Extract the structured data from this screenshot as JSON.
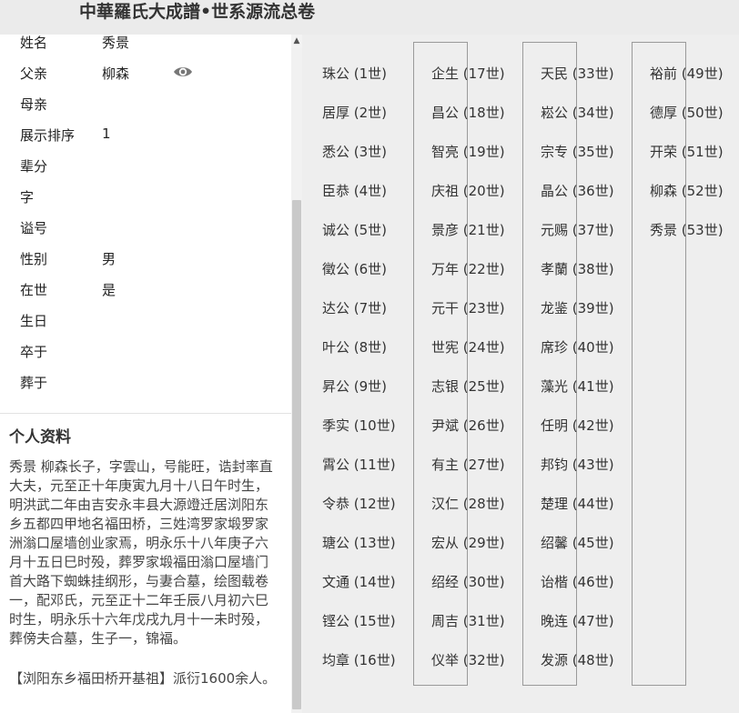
{
  "header": {
    "title": "中華羅氏大成譜•世系源流总卷"
  },
  "profile": {
    "fields": [
      {
        "label": "姓名",
        "value": "秀景"
      },
      {
        "label": "父亲",
        "value": "柳森"
      },
      {
        "label": "母亲",
        "value": ""
      },
      {
        "label": "展示排序",
        "value": "1"
      },
      {
        "label": "辈分",
        "value": ""
      },
      {
        "label": "字",
        "value": ""
      },
      {
        "label": "谥号",
        "value": ""
      },
      {
        "label": "性别",
        "value": "男"
      },
      {
        "label": "在世",
        "value": "是"
      },
      {
        "label": "生日",
        "value": ""
      },
      {
        "label": "卒于",
        "value": ""
      },
      {
        "label": "葬于",
        "value": ""
      }
    ],
    "icons": {
      "view": "eye-icon"
    },
    "section_title": "个人资料",
    "bio": "秀景 柳森长子，字雲山，号能旺，诰封率直大夫，元至正十年庚寅九月十八日午时生，明洪武二年由吉安永丰县大源竳迁居浏阳东乡五都四甲地名福田桥，三姓湾罗家塅罗家洲滃口屋墙创业家焉，明永乐十八年庚子六月十五日巳时殁，葬罗家塅福田滃口屋墙门首大路下蜘蛛挂纲形，与妻合墓，绘图载卷一，配邓氏，元至正十二年壬辰八月初六巳时生，明永乐十六年戊戌九月十一未时殁，葬傍夫合墓，生子一，锦福。",
    "origin": "【浏阳东乡福田桥开基祖】派衍1600余人。"
  },
  "generations": [
    [
      "珠公 (1世)",
      "居厚 (2世)",
      "悉公 (3世)",
      "臣恭 (4世)",
      "诚公 (5世)",
      "徵公 (6世)",
      "达公 (7世)",
      "叶公 (8世)",
      "昇公 (9世)",
      "季实 (10世)",
      "霄公 (11世)",
      "令恭 (12世)",
      "瑭公 (13世)",
      "文通 (14世)",
      "铿公 (15世)",
      "均章 (16世)"
    ],
    [
      "企生 (17世)",
      "昌公 (18世)",
      "智亮 (19世)",
      "庆祖 (20世)",
      "景彦 (21世)",
      "万年 (22世)",
      "元干 (23世)",
      "世宪 (24世)",
      "志银 (25世)",
      "尹斌 (26世)",
      "有主 (27世)",
      "汉仁 (28世)",
      "宏从 (29世)",
      "绍经 (30世)",
      "周吉 (31世)",
      "仪举 (32世)"
    ],
    [
      "天民 (33世)",
      "崧公 (34世)",
      "宗专 (35世)",
      "晶公 (36世)",
      "元赐 (37世)",
      "孝蘭 (38世)",
      "龙鉴 (39世)",
      "席珍 (40世)",
      "藻光 (41世)",
      "任明 (42世)",
      "邦钧 (43世)",
      "楚理 (44世)",
      "绍馨 (45世)",
      "诒楷 (46世)",
      "晚连 (47世)",
      "发源 (48世)"
    ],
    [
      "裕前 (49世)",
      "德厚 (50世)",
      "开荣 (51世)",
      "柳森 (52世)",
      "秀景 (53世)"
    ]
  ]
}
